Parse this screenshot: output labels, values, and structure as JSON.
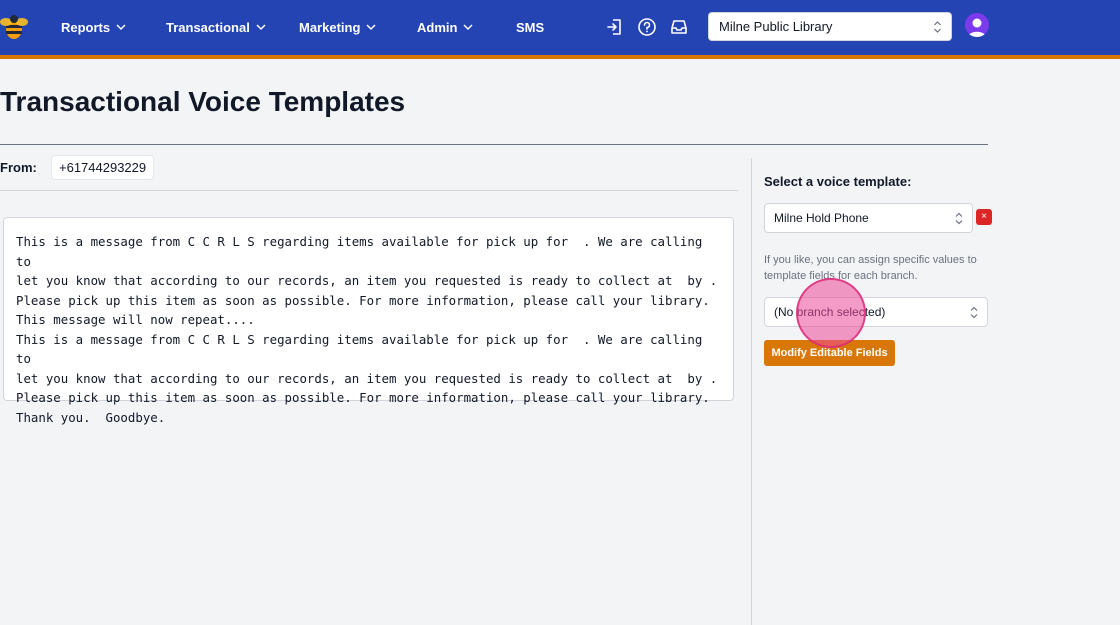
{
  "nav": {
    "items": [
      {
        "label": "Reports",
        "has_dropdown": true
      },
      {
        "label": "Transactional",
        "has_dropdown": true
      },
      {
        "label": "Marketing",
        "has_dropdown": true
      },
      {
        "label": "Admin",
        "has_dropdown": true
      },
      {
        "label": "SMS",
        "has_dropdown": false
      }
    ],
    "icons": [
      "logout-icon",
      "help-icon",
      "inbox-icon"
    ],
    "library_select": "Milne Public Library"
  },
  "page": {
    "title": "Transactional Voice Templates",
    "from_label": "From:",
    "from_value": "+61744293229",
    "message": "This is a message from C C R L S regarding items available for pick up for  . We are calling to\nlet you know that according to our records, an item you requested is ready to collect at  by .\nPlease pick up this item as soon as possible. For more information, please call your library.\nThis message will now repeat....\nThis is a message from C C R L S regarding items available for pick up for  . We are calling to\nlet you know that according to our records, an item you requested is ready to collect at  by .\nPlease pick up this item as soon as possible. For more information, please call your library.\nThank you.  Goodbye."
  },
  "panel": {
    "heading": "Select a voice template:",
    "template_select": "Milne Hold Phone",
    "remove_label": "×",
    "help_text": "If you like, you can assign specific values to template fields for each branch.",
    "branch_select": "(No branch selected)",
    "modify_button": "Modify Editable Fields"
  },
  "colors": {
    "navbar": "#2444b4",
    "accent": "#d97706",
    "danger": "#dc2626",
    "avatar": "#7c3aed",
    "click_indicator": "#ec4899"
  }
}
